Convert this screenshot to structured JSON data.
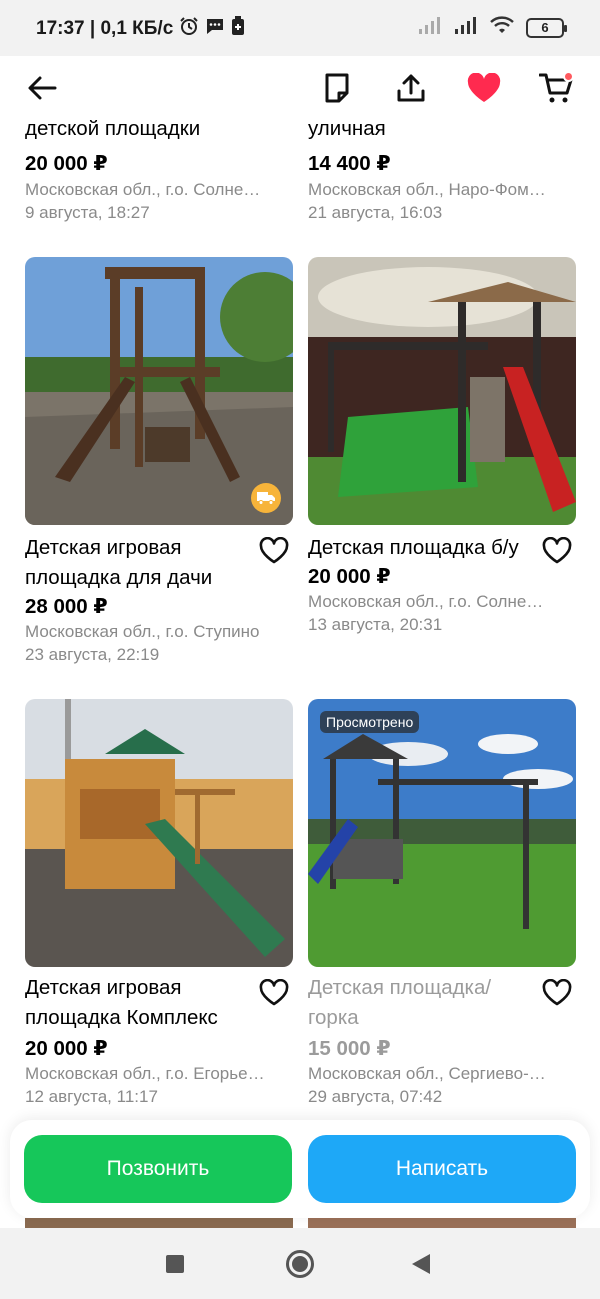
{
  "status_bar": {
    "time_speed": "17:37 | 0,1 КБ/с",
    "battery": "6"
  },
  "toolbar": {
    "back_icon": "arrow-left-icon",
    "note_icon": "note-icon",
    "share_icon": "share-icon",
    "favorite_icon": "heart-filled-icon",
    "cart_icon": "cart-icon"
  },
  "colors": {
    "heart": "#ff2a4f",
    "call_button": "#16c75a",
    "message_button": "#1ea8f7",
    "cart_dot": "#ff5a5f"
  },
  "listings_top": [
    {
      "title_tail": "детской площадки",
      "price": "20 000 ₽",
      "location": "Московская обл., г.о. Солне…",
      "date": "9 августа, 18:27"
    },
    {
      "title_tail": "уличная",
      "price": "14 400 ₽",
      "location": "Московская обл., Наро-Фом…",
      "date": "21 августа, 16:03"
    }
  ],
  "listings": [
    {
      "title_line1": "Детская игровая",
      "title_line2": "площадка для дачи",
      "price": "28 000 ₽",
      "location": "Московская обл., г.о. Ступино",
      "date": "23 августа, 22:19",
      "badge_icon": "delivery-truck-icon"
    },
    {
      "title_line1": "Детская площадка б/у",
      "price": "20 000 ₽",
      "location": "Московская обл., г.о. Солне…",
      "date": "13 августа, 20:31"
    },
    {
      "title_line1": "Детская игровая",
      "title_line2": "площадка Комплекс",
      "price": "20 000 ₽",
      "location": "Московская обл., г.о. Егорье…",
      "date": "12 августа, 11:17"
    },
    {
      "badge": "Просмотрено",
      "title_line1": "Детская площадка/",
      "title_line2": "горка",
      "price": "15 000 ₽",
      "location": "Московская обл., Сергиево-…",
      "date": "29 августа, 07:42"
    }
  ],
  "actions": {
    "call": "Позвонить",
    "message": "Написать"
  },
  "nav": {
    "recents_icon": "square-icon",
    "home_icon": "circle-icon",
    "back_icon": "triangle-back-icon"
  }
}
